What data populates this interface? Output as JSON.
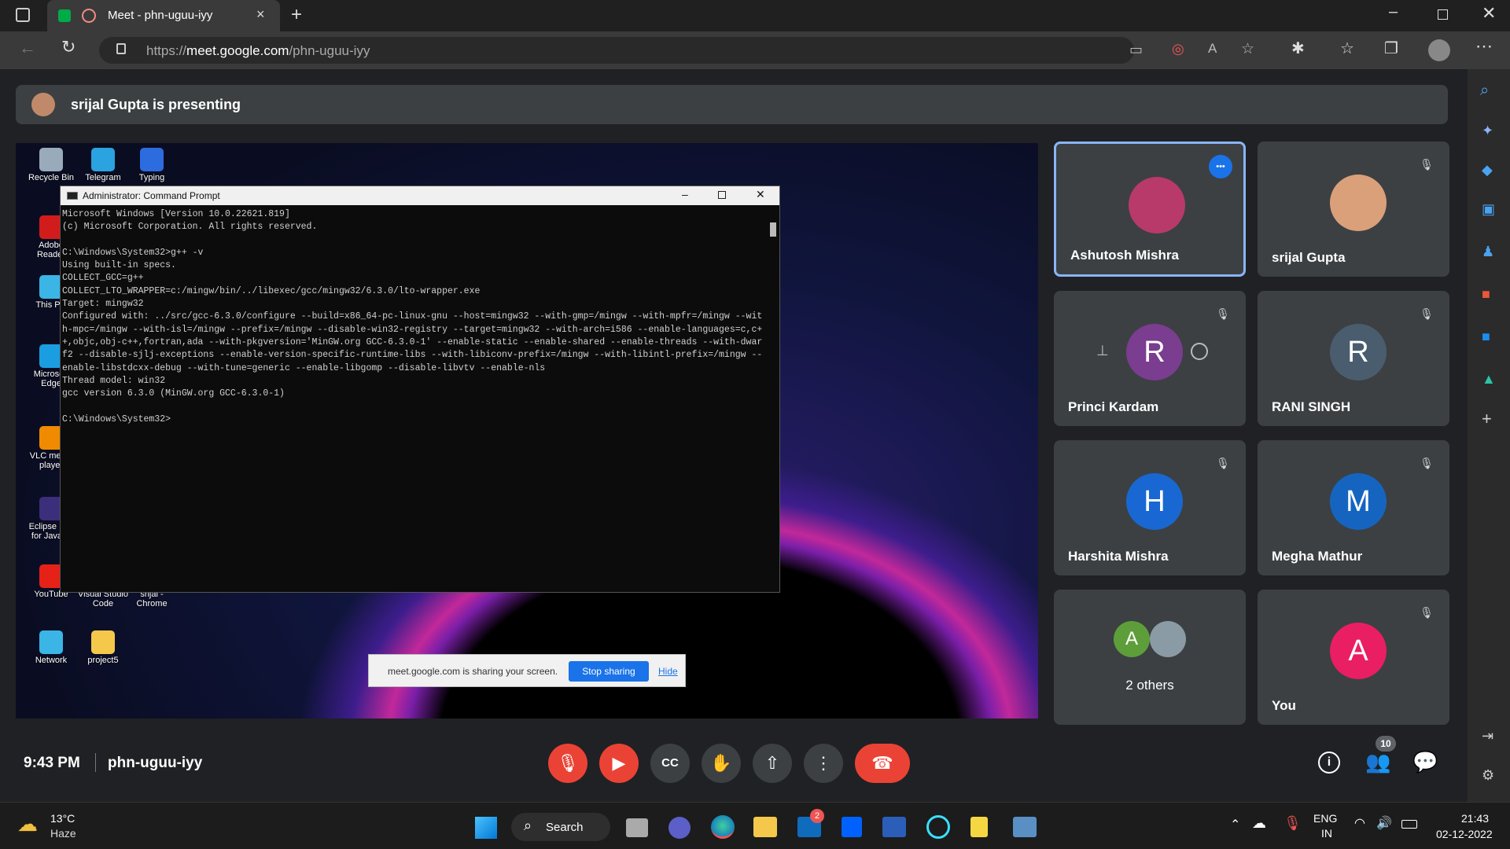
{
  "browser": {
    "tab_title": "Meet - phn-uguu-iyy",
    "url_prefix": "https://",
    "url_host": "meet.google.com",
    "url_path": "/phn-uguu-iyy"
  },
  "presenting": {
    "text": "srijal Gupta is presenting"
  },
  "desktop": {
    "icons": [
      {
        "label": "Recycle Bin",
        "color": "#9ab"
      },
      {
        "label": "Telegram",
        "color": "#2aa3e0"
      },
      {
        "label": "Typing",
        "color": "#2d6cdf"
      },
      {
        "label": "Adobe Reader",
        "color": "#d21c1c"
      },
      {
        "label": "This PC",
        "color": "#3ab5e6"
      },
      {
        "label": "Microsoft Edge",
        "color": "#1b9de2"
      },
      {
        "label": "VLC media player",
        "color": "#f08a00"
      },
      {
        "label": "Eclipse IDE for Java D",
        "color": "#3b2e7a"
      },
      {
        "label": "YouTube",
        "color": "#e62117"
      },
      {
        "label": "Visual Studio Code",
        "color": "#1f8ad2"
      },
      {
        "label": "srijal - Chrome",
        "color": "#4285f4"
      },
      {
        "label": "Network",
        "color": "#3ab5e6"
      },
      {
        "label": "project5",
        "color": "#f5c84c"
      }
    ],
    "cmd_title": "Administrator: Command Prompt",
    "cmd_text": "Microsoft Windows [Version 10.0.22621.819]\n(c) Microsoft Corporation. All rights reserved.\n\nC:\\Windows\\System32>g++ -v\nUsing built-in specs.\nCOLLECT_GCC=g++\nCOLLECT_LTO_WRAPPER=c:/mingw/bin/../libexec/gcc/mingw32/6.3.0/lto-wrapper.exe\nTarget: mingw32\nConfigured with: ../src/gcc-6.3.0/configure --build=x86_64-pc-linux-gnu --host=mingw32 --with-gmp=/mingw --with-mpfr=/mingw --with-mpc=/mingw --with-isl=/mingw --prefix=/mingw --disable-win32-registry --target=mingw32 --with-arch=i586 --enable-languages=c,c++,objc,obj-c++,fortran,ada --with-pkgversion='MinGW.org GCC-6.3.0-1' --enable-static --enable-shared --enable-threads --with-dwarf2 --disable-sjlj-exceptions --enable-version-specific-runtime-libs --with-libiconv-prefix=/mingw --with-libintl-prefix=/mingw --enable-libstdcxx-debug --with-tune=generic --enable-libgomp --disable-libvtv --enable-nls\nThread model: win32\ngcc version 6.3.0 (MinGW.org GCC-6.3.0-1)\n\nC:\\Windows\\System32>",
    "share_text": "meet.google.com is sharing your screen.",
    "stop_sharing": "Stop sharing",
    "hide": "Hide"
  },
  "participants": [
    {
      "name": "Ashutosh Mishra",
      "initial": "",
      "color": "#b83a6a",
      "muted": false,
      "active": true
    },
    {
      "name": "srijal Gupta",
      "initial": "",
      "color": "#d9a07a",
      "muted": true
    },
    {
      "name": "Princi Kardam",
      "initial": "R",
      "color": "#7a3d8f",
      "muted": true
    },
    {
      "name": "RANI SINGH",
      "initial": "R",
      "color": "#4a5d6e",
      "muted": true
    },
    {
      "name": "Harshita Mishra",
      "initial": "H",
      "color": "#1967d2",
      "muted": true
    },
    {
      "name": "Megha Mathur",
      "initial": "M",
      "color": "#1565c0",
      "muted": true
    },
    {
      "name": "2 others",
      "initial": "A",
      "color": "#5e9e3a",
      "muted": false
    },
    {
      "name": "You",
      "initial": "A",
      "color": "#e91e63",
      "muted": true
    }
  ],
  "bottom": {
    "time": "9:43 PM",
    "meeting_code": "phn-uguu-iyy",
    "people_count": "10"
  },
  "taskbar": {
    "temp": "13°C",
    "weather": "Haze",
    "search": "Search",
    "lang": "ENG",
    "region": "IN",
    "clock": "21:43",
    "date": "02-12-2022",
    "mail_badge": "2"
  }
}
